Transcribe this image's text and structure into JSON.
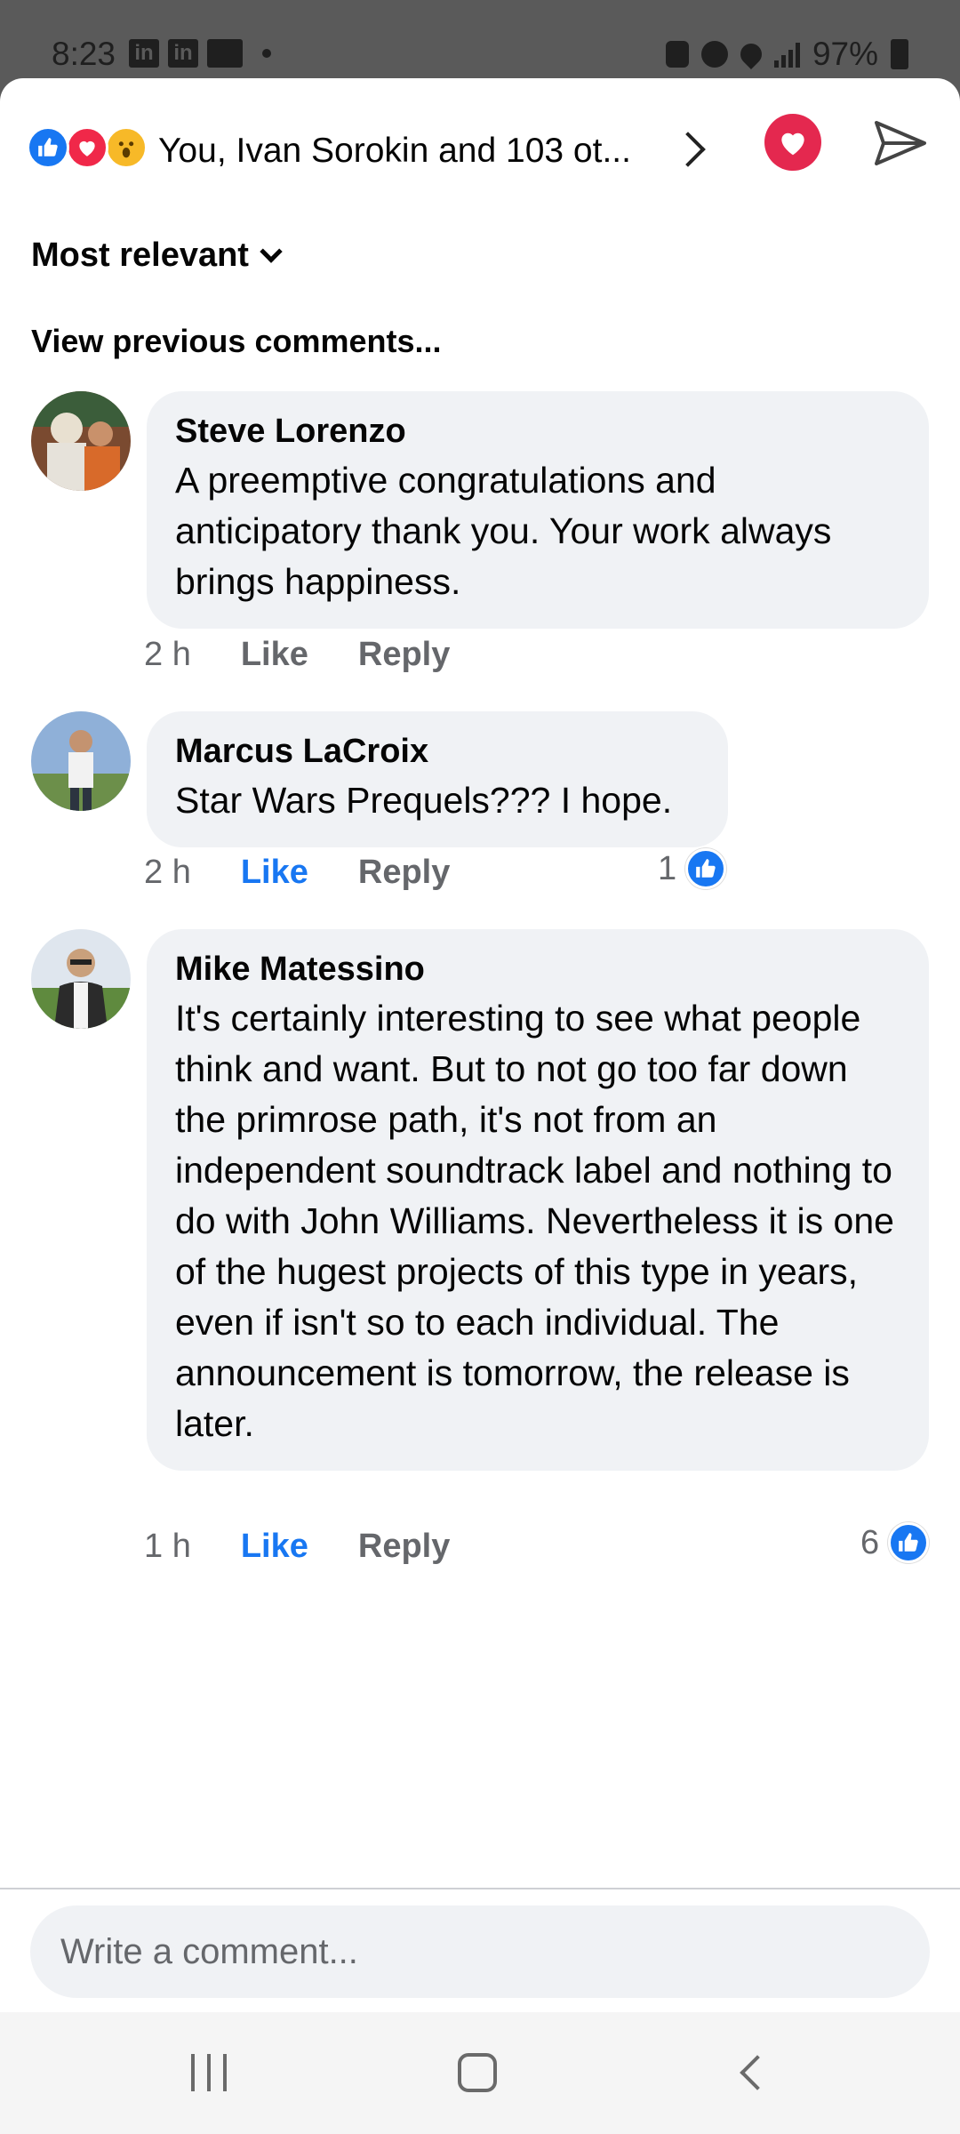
{
  "status_bar": {
    "time": "8:23",
    "left_icons": [
      "linkedin-icon",
      "linkedin-icon",
      "outlook-icon",
      "notification-dot"
    ],
    "right_icons": [
      "lock-icon",
      "alarm-icon",
      "location-icon",
      "data-icon",
      "signal-icon"
    ],
    "battery": "97%"
  },
  "header": {
    "reaction_types": [
      "like",
      "love",
      "wow"
    ],
    "reactors": "You, Ivan Sorokin and 103 ot...",
    "love_color": "#e4284f"
  },
  "sort": {
    "label": "Most relevant"
  },
  "view_previous": "View previous comments...",
  "comments": [
    {
      "author": "Steve Lorenzo",
      "text": "A preemptive congratulations and anticipatory thank you. Your work always brings happiness.",
      "time": "2 h",
      "like_label": "Like",
      "reply_label": "Reply",
      "liked": false,
      "reaction_count": null
    },
    {
      "author": "Marcus LaCroix",
      "text": "Star Wars Prequels??? I hope.",
      "time": "2 h",
      "like_label": "Like",
      "reply_label": "Reply",
      "liked": true,
      "reaction_count": "1"
    },
    {
      "author": "Mike Matessino",
      "text": "It's certainly interesting to see what people think and want. But to not go too far down the primrose path, it's not from an independent soundtrack label and nothing to do with John Williams. Nevertheless it is one of the hugest projects of this type in years, even if isn't so to each individual. The announcement is tomorrow, the release is later.",
      "time": "1 h",
      "like_label": "Like",
      "reply_label": "Reply",
      "liked": true,
      "reaction_count": "6"
    }
  ],
  "composer": {
    "placeholder": "Write a comment..."
  },
  "colors": {
    "accent": "#1877f2",
    "bubble": "#f0f2f5",
    "meta": "#65676b"
  }
}
